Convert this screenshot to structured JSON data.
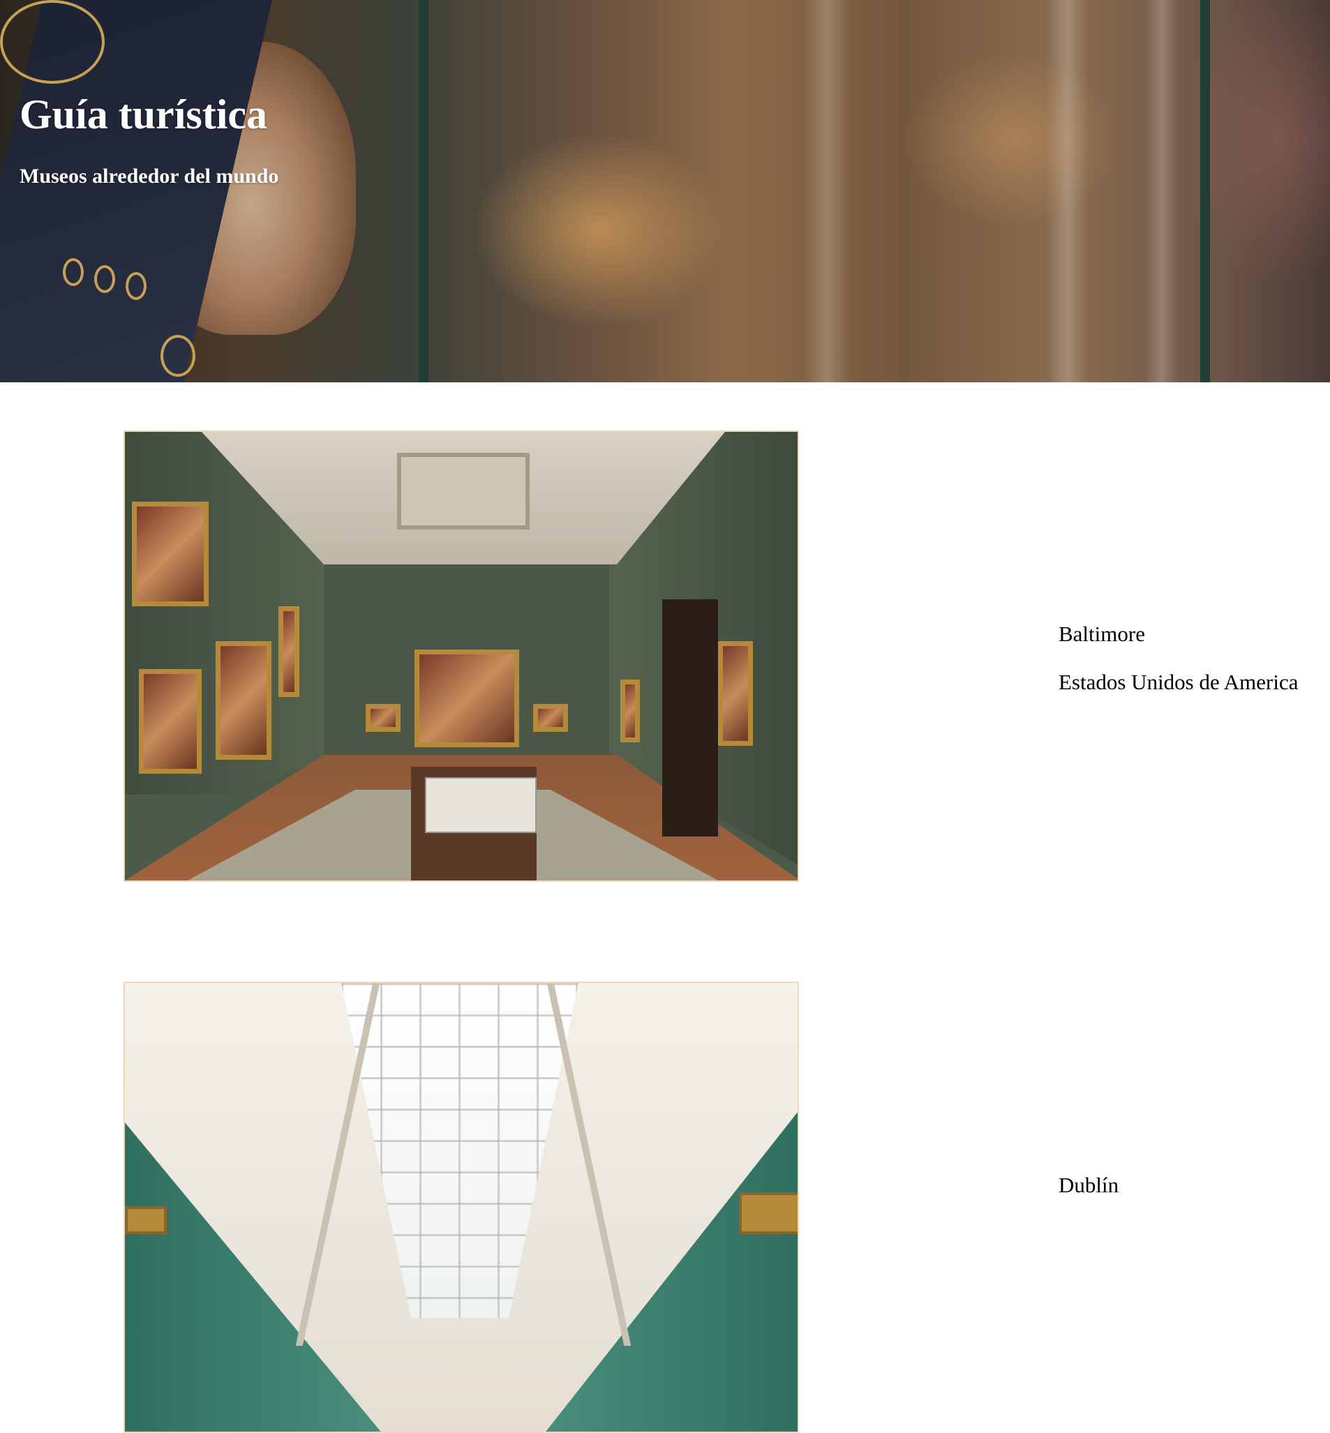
{
  "hero": {
    "title": "Guía turística",
    "subtitle": "Museos alrededor del mundo"
  },
  "museums": [
    {
      "city": "Baltimore",
      "country": "Estados Unidos de America",
      "photo": "museum-gallery-green-room"
    },
    {
      "city": "Dublín",
      "country": "",
      "photo": "museum-gallery-skylight-hall"
    }
  ],
  "colors": {
    "hero_text": "#ffffff",
    "photo_border": "#f0d9b5",
    "body_text": "#000000"
  }
}
